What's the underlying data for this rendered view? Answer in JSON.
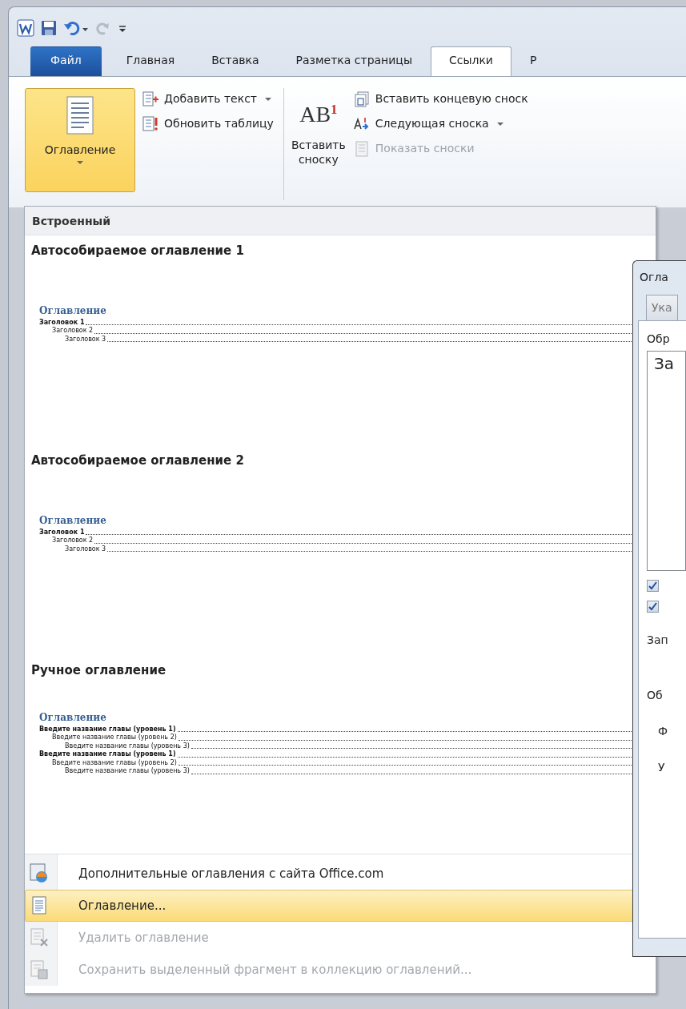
{
  "tabs": [
    {
      "label": "Файл",
      "kind": "file",
      "selected": false
    },
    {
      "label": "Главная",
      "kind": "tab",
      "selected": false
    },
    {
      "label": "Вставка",
      "kind": "tab",
      "selected": false
    },
    {
      "label": "Разметка страницы",
      "kind": "tab",
      "selected": false
    },
    {
      "label": "Ссылки",
      "kind": "tab",
      "selected": true
    },
    {
      "label": "Р",
      "kind": "tab",
      "selected": false
    }
  ],
  "ribbon": {
    "groups": [
      {
        "large": {
          "label": "Оглавление",
          "pressed": true,
          "dropdown": true
        },
        "small": [
          {
            "label": "Добавить текст",
            "dropdown": true,
            "disabled": false
          },
          {
            "label": "Обновить таблицу",
            "dropdown": false,
            "disabled": false
          }
        ]
      },
      {
        "large": {
          "label": "Вставить сноску",
          "glyph": "AB",
          "glyph_sup": "1"
        },
        "small": [
          {
            "label": "Вставить концевую сноск",
            "dropdown": false,
            "disabled": false
          },
          {
            "label": "Следующая сноска",
            "dropdown": true,
            "disabled": false
          },
          {
            "label": "Показать сноски",
            "dropdown": false,
            "disabled": true
          }
        ]
      }
    ]
  },
  "menu": {
    "header": "Встроенный",
    "gallery": [
      {
        "title": "Автособираемое оглавление 1",
        "preview": {
          "heading": "Оглавление",
          "entries": [
            {
              "text": "Заголовок 1",
              "children": [
                {
                  "text": "Заголовок 2",
                  "children": [
                    {
                      "text": "Заголовок 3"
                    }
                  ]
                }
              ]
            }
          ]
        }
      },
      {
        "title": "Автособираемое оглавление 2",
        "preview": {
          "heading": "Оглавление",
          "entries": [
            {
              "text": "Заголовок 1",
              "children": [
                {
                  "text": "Заголовок 2",
                  "children": [
                    {
                      "text": "Заголовок 3"
                    }
                  ]
                }
              ]
            }
          ]
        }
      },
      {
        "title": "Ручное оглавление",
        "preview": {
          "heading": "Оглавление",
          "entries": [
            {
              "text": "Введите название главы (уровень 1)",
              "children": [
                {
                  "text": "Введите название главы (уровень 2)",
                  "children": [
                    {
                      "text": "Введите название главы (уровень 3)"
                    }
                  ]
                }
              ]
            },
            {
              "text": "Введите название главы (уровень 1)",
              "children": [
                {
                  "text": "Введите название главы (уровень 2)",
                  "children": [
                    {
                      "text": "Введите название главы (уровень 3)"
                    }
                  ]
                }
              ]
            }
          ]
        }
      }
    ],
    "commands": [
      {
        "label": "Дополнительные оглавления с сайта Office.com",
        "selected": false,
        "disabled": false
      },
      {
        "label": "Оглавление...",
        "selected": true,
        "disabled": false
      },
      {
        "label": "Удалить оглавление",
        "selected": false,
        "disabled": true
      },
      {
        "label": "Сохранить выделенный фрагмент в коллекцию оглавлений...",
        "selected": false,
        "disabled": true
      }
    ]
  },
  "dialog": {
    "title": "Огла",
    "tab": "Ука",
    "preview_label": "Обр",
    "preview_text": "За",
    "checkboxes": [
      {
        "checked": true
      },
      {
        "checked": true
      }
    ],
    "labels": [
      "Зап",
      "Об",
      "Ф",
      "У"
    ]
  }
}
